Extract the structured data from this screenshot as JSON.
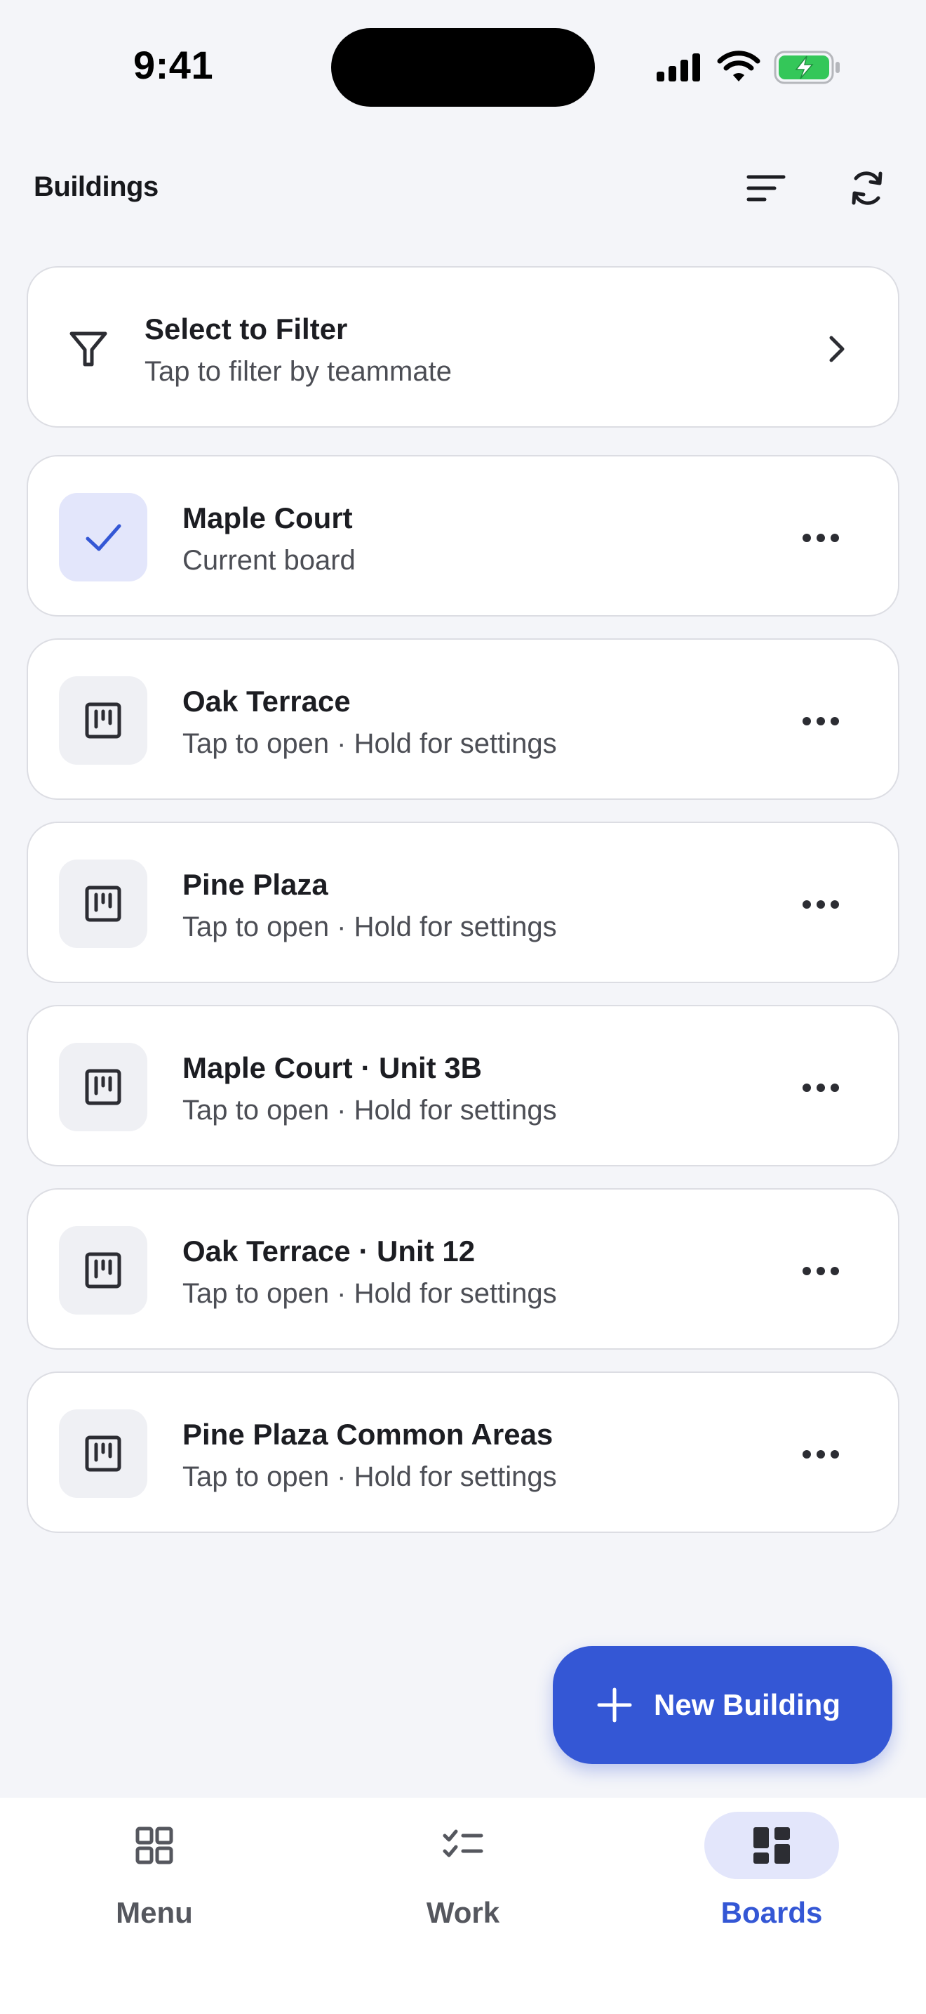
{
  "status_bar": {
    "time": "9:41"
  },
  "header": {
    "title": "Buildings"
  },
  "filter": {
    "title": "Select to Filter",
    "subtitle": "Tap to filter by teammate"
  },
  "boards": [
    {
      "title": "Maple Court",
      "subtitle": "Current board",
      "current": true
    },
    {
      "title": "Oak Terrace",
      "subtitle": "Tap to open · Hold for settings",
      "current": false
    },
    {
      "title": "Pine Plaza",
      "subtitle": "Tap to open · Hold for settings",
      "current": false
    },
    {
      "title": "Maple Court · Unit 3B",
      "subtitle": "Tap to open · Hold for settings",
      "current": false
    },
    {
      "title": "Oak Terrace · Unit 12",
      "subtitle": "Tap to open · Hold for settings",
      "current": false
    },
    {
      "title": "Pine Plaza Common Areas",
      "subtitle": "Tap to open · Hold for settings",
      "current": false
    }
  ],
  "fab": {
    "label": "New Building"
  },
  "nav": {
    "items": [
      {
        "label": "Menu",
        "icon": "grid-icon",
        "active": false
      },
      {
        "label": "Work",
        "icon": "checklist-icon",
        "active": false
      },
      {
        "label": "Boards",
        "icon": "dashboard-icon",
        "active": true
      }
    ]
  },
  "colors": {
    "accent": "#3457D5",
    "background": "#F4F5F9",
    "card": "#FFFFFF",
    "active_tint": "#E3E6FB",
    "battery": "#34C759"
  }
}
